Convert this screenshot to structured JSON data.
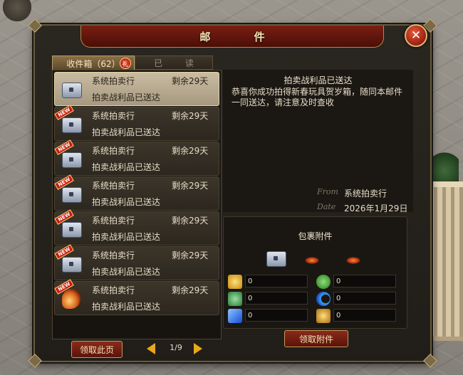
{
  "window": {
    "title": "邮 件",
    "close_symbol": "✕"
  },
  "tabs": [
    {
      "label": "收件箱（62）",
      "active": true,
      "badge": "礼"
    },
    {
      "label": "已 读",
      "active": false
    }
  ],
  "mail_list": [
    {
      "sender": "系统拍卖行",
      "days": "剩余29天",
      "subject": "拍卖战利品已送达",
      "icon": "chest-icon",
      "is_new": false,
      "selected": true
    },
    {
      "sender": "系统拍卖行",
      "days": "剩余29天",
      "subject": "拍卖战利品已送达",
      "icon": "chest-icon",
      "is_new": true,
      "new_label": "NEW"
    },
    {
      "sender": "系统拍卖行",
      "days": "剩余29天",
      "subject": "拍卖战利品已送达",
      "icon": "chest-icon",
      "is_new": true,
      "new_label": "NEW"
    },
    {
      "sender": "系统拍卖行",
      "days": "剩余29天",
      "subject": "拍卖战利品已送达",
      "icon": "chest-icon",
      "is_new": true,
      "new_label": "NEW"
    },
    {
      "sender": "系统拍卖行",
      "days": "剩余29天",
      "subject": "拍卖战利品已送达",
      "icon": "chest-icon",
      "is_new": true,
      "new_label": "NEW"
    },
    {
      "sender": "系统拍卖行",
      "days": "剩余29天",
      "subject": "拍卖战利品已送达",
      "icon": "chest-icon",
      "is_new": true,
      "new_label": "NEW"
    },
    {
      "sender": "系统拍卖行",
      "days": "剩余29天",
      "subject": "拍卖战利品已送达",
      "icon": "flame-item-icon",
      "is_new": true,
      "new_label": "NEW"
    }
  ],
  "pager": {
    "claim_label": "领取此页",
    "page": "1/9"
  },
  "detail": {
    "title": "拍卖战利品已送达",
    "body": "恭喜你成功拍得新春玩具贺岁箱，随同本邮件一同送达，请注意及时查收",
    "from_label": "From",
    "from_value": "系统拍卖行",
    "date_label": "Date",
    "date_value": "2026年1月29日"
  },
  "attachments": {
    "title": "包裹附件",
    "items": [
      {
        "icon": "gold-ingot-icon",
        "value": "0",
        "color": "#e0b030"
      },
      {
        "icon": "green-orb-icon",
        "value": "0",
        "color": "#4aa83a"
      },
      {
        "icon": "jade-coin-icon",
        "value": "0",
        "color": "#3a9a5a"
      },
      {
        "icon": "blue-crescent-icon",
        "value": "0",
        "color": "#2a78d8"
      },
      {
        "icon": "blue-crystal-icon",
        "value": "0",
        "color": "#2a5ad8"
      },
      {
        "icon": "gold-emblem-icon",
        "value": "0",
        "color": "#d8a020"
      }
    ],
    "collect_label": "领取附件"
  }
}
